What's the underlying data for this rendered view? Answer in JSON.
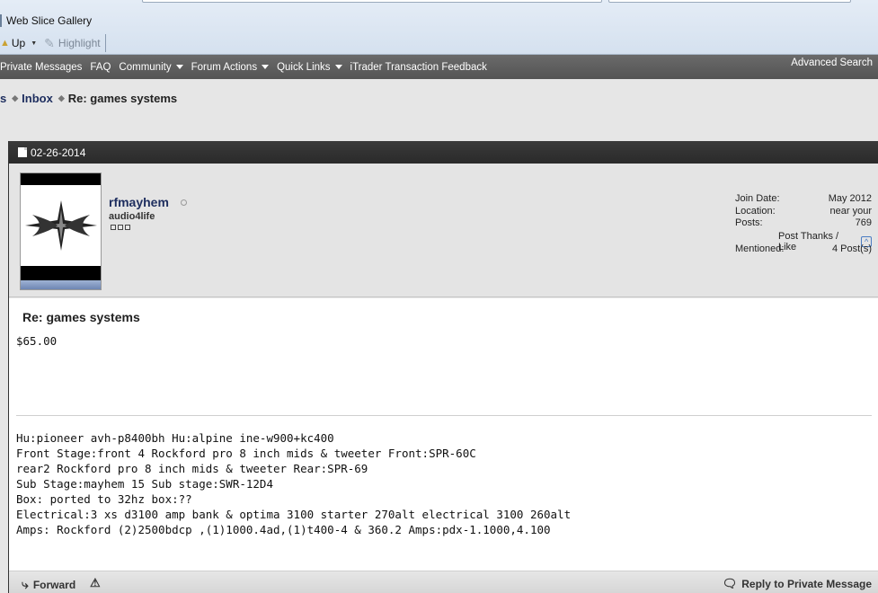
{
  "browser": {
    "favorites": {
      "web_slice_gallery": "Web Slice Gallery"
    },
    "toolbar": {
      "up_label": "Up",
      "highlight_label": "Highlight"
    }
  },
  "navbar": {
    "items": [
      "Private Messages",
      "FAQ",
      "Community",
      "Forum Actions",
      "Quick Links",
      "iTrader Transaction Feedback"
    ],
    "advanced_search": "Advanced Search"
  },
  "breadcrumb": {
    "prefix": "s",
    "inbox": "Inbox",
    "current": "Re: games systems"
  },
  "post": {
    "date": "02-26-2014",
    "user": {
      "name": "rfmayhem",
      "title": "audio4life"
    },
    "stats": {
      "join_date_label": "Join Date:",
      "join_date_value": "May 2012",
      "location_label": "Location:",
      "location_value": "near your",
      "posts_label": "Posts:",
      "posts_value": "769",
      "thanks_label": "Post Thanks / Like",
      "mentioned_label": "Mentioned:",
      "mentioned_value": "4 Post(s)"
    },
    "title": "Re: games systems",
    "body": "$65.00",
    "signature": [
      "Hu:pioneer avh-p8400bh Hu:alpine ine-w900+kc400",
      "Front Stage:front 4 Rockford pro 8 inch mids & tweeter Front:SPR-60C",
      "rear2 Rockford pro 8 inch mids & tweeter Rear:SPR-69",
      "Sub Stage:mayhem 15 Sub stage:SWR-12D4",
      "Box: ported to 32hz box:??",
      "Electrical:3 xs d3100 amp bank & optima 3100 starter 270alt electrical 3100 260alt",
      "Amps: Rockford (2)2500bdcp ,(1)1000.4ad,(1)t400-4 & 360.2 Amps:pdx-1.1000,4.100"
    ],
    "footer": {
      "forward_label": "Forward",
      "reply_label": "Reply to Private Message"
    }
  }
}
